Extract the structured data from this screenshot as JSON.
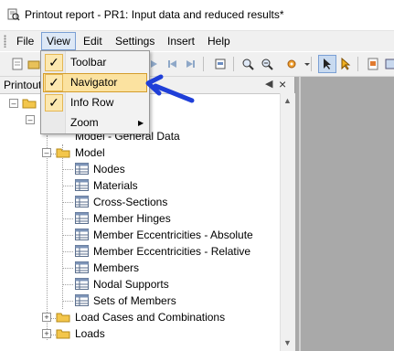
{
  "window": {
    "title": "Printout report - PR1: Input data and reduced results*"
  },
  "menubar": {
    "items": [
      "File",
      "View",
      "Edit",
      "Settings",
      "Insert",
      "Help"
    ]
  },
  "view_menu": {
    "items": [
      {
        "label": "Toolbar",
        "checked": true
      },
      {
        "label": "Navigator",
        "checked": true,
        "highlighted": true
      },
      {
        "label": "Info Row",
        "checked": true
      },
      {
        "label": "Zoom",
        "has_submenu": true
      }
    ]
  },
  "panel": {
    "title": "Printout"
  },
  "tree": {
    "partial_item": "Model - General Data",
    "model": "Model",
    "model_children": [
      "Nodes",
      "Materials",
      "Cross-Sections",
      "Member Hinges",
      "Member Eccentricities - Absolute",
      "Member Eccentricities - Relative",
      "Members",
      "Nodal Supports",
      "Sets of Members"
    ],
    "load_cases": "Load Cases and Combinations",
    "loads": "Loads"
  },
  "colors": {
    "highlight_fill": "#fbe2a0",
    "highlight_border": "#d49d2c",
    "callout_arrow": "#1f3fd8",
    "workspace": "#a9a9a9"
  }
}
